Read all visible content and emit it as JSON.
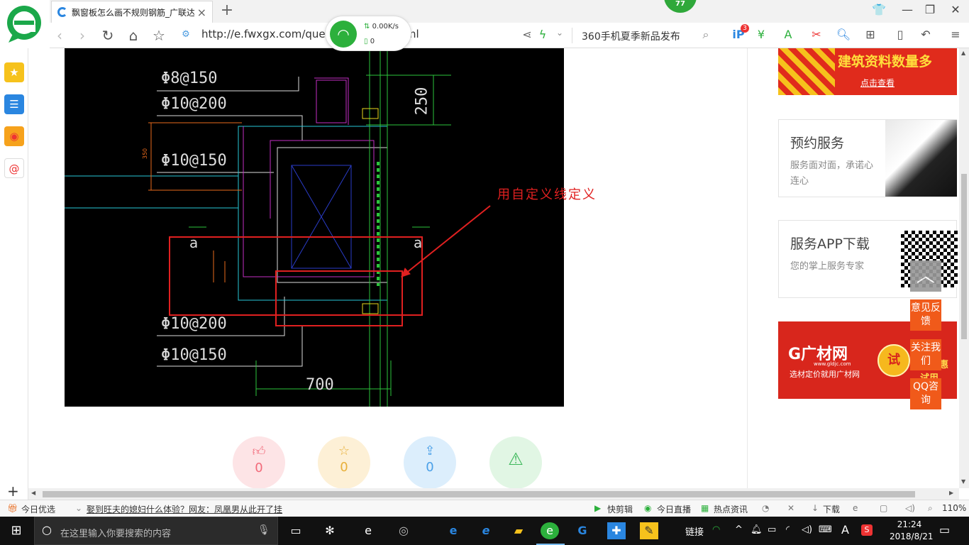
{
  "browser": {
    "tab_title": "飘窗板怎么画不规则钢筋_广联达",
    "url": "http://e.fwxgx.com/ques",
    "url_tail": "tml",
    "search_hint": "360手机夏季新品发布",
    "badge_count": "77",
    "net_speed_up": "0.00K/s",
    "net_speed_down": "0",
    "ext_badge": "3"
  },
  "cad": {
    "labels": [
      "Φ8@150",
      "Φ10@200",
      "Φ10@150",
      "Φ10@200",
      "Φ10@150"
    ],
    "dim_250": "250",
    "dim_700": "700",
    "dim_350": "350",
    "axis_a": "a",
    "annotation": "用自定义线定义"
  },
  "actions": {
    "like_count": "0",
    "fav_count": "0",
    "share_count": "0"
  },
  "sidebar_right": {
    "ad_top_title": "建筑资料数量多",
    "ad_top_btn": "点击查看",
    "card1_title": "预约服务",
    "card1_sub": "服务面对面，承诺心连心",
    "card2_title": "服务APP下载",
    "card2_sub": "您的掌上服务专家",
    "ad_gc_logo": "G广材网",
    "ad_gc_url": "www.gldjc.com",
    "ad_gc_sub": "选材定价就用广材网",
    "ad_gc_try": "试",
    "ad_gc_tail": "P 优惠试用"
  },
  "float": {
    "feedback": "意见反馈",
    "follow": "关注我们",
    "qq": "QQ咨询"
  },
  "statusbar": {
    "today": "今日优选",
    "news": "娶到旺夫的媳妇什么体验？网友：凤凰男从此开了挂",
    "clip": "快剪辑",
    "live": "今日直播",
    "hot": "热点资讯",
    "download": "下载",
    "zoom": "110%"
  },
  "taskbar": {
    "search_placeholder": "在这里输入你要搜索的内容",
    "link": "链接",
    "time": "21:24",
    "date": "2018/8/21"
  }
}
